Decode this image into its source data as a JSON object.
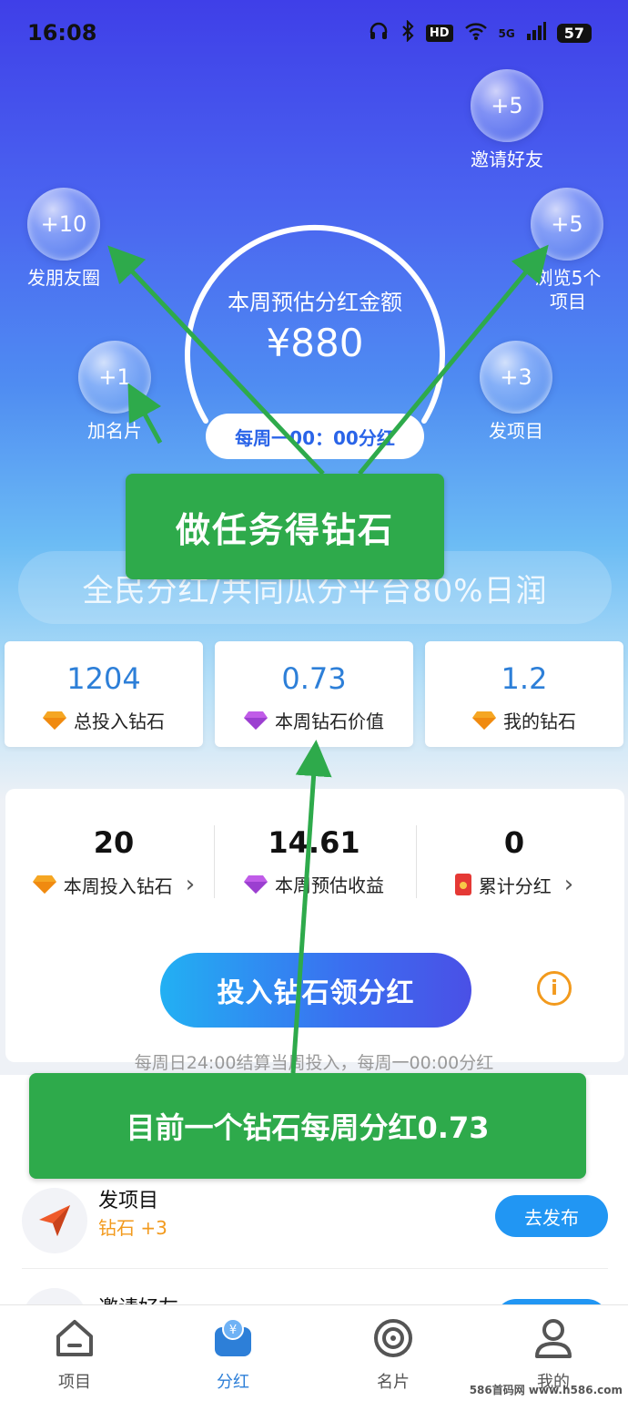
{
  "status_bar": {
    "time": "16:08",
    "network": "5G",
    "hd": "HD",
    "battery": "57"
  },
  "bubbles": [
    {
      "id": "invite",
      "value": "+5",
      "label": "邀请好友"
    },
    {
      "id": "moments",
      "value": "+10",
      "label": "发朋友圈"
    },
    {
      "id": "browse",
      "value": "+5",
      "label_line1": "浏览5个",
      "label_line2": "项目"
    },
    {
      "id": "card",
      "value": "+1",
      "label": "加名片"
    },
    {
      "id": "publish",
      "value": "+3",
      "label": "发项目"
    }
  ],
  "dial": {
    "title": "本周预估分红金额",
    "amount": "¥880",
    "schedule": "每周一00：00分红"
  },
  "slogan": "全民分红/共同瓜分平台80%日润",
  "stats": [
    {
      "value": "1204",
      "label": "总投入钻石"
    },
    {
      "value": "0.73",
      "label": "本周钻石价值"
    },
    {
      "value": "1.2",
      "label": "我的钻石"
    }
  ],
  "panel": {
    "items": [
      {
        "value": "20",
        "label": "本周投入钻石"
      },
      {
        "value": "14.61",
        "label": "本周预估收益"
      },
      {
        "value": "0",
        "label": "累计分红"
      }
    ],
    "invest_button": "投入钻石领分红",
    "info_glyph": "i",
    "settle_note": "每周日24:00结算当周投入，每周一00:00分红"
  },
  "tasks": [
    {
      "title": "发项目",
      "reward": "钻石 +3",
      "button": "去发布"
    },
    {
      "title": "邀请好友"
    }
  ],
  "tabs": [
    {
      "label": "项目",
      "active": false
    },
    {
      "label": "分红",
      "active": true
    },
    {
      "label": "名片",
      "active": false
    },
    {
      "label": "我的",
      "active": false
    }
  ],
  "annotations": {
    "callout_tasks": "做任务得钻石",
    "callout_value": "目前一个钻石每周分红0.73",
    "color": "#2eaa4b"
  },
  "watermark": "586首码网 www.h586.com",
  "colors": {
    "accent_blue": "#2d7fd8",
    "button_blue": "#2196f3",
    "reward_orange": "#f29a1d"
  }
}
